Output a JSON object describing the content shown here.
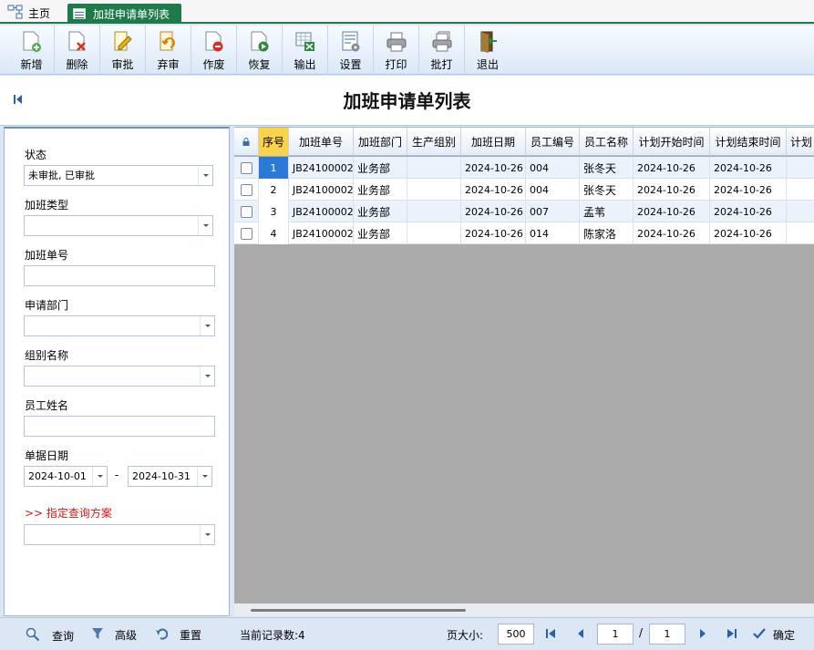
{
  "tabs": {
    "home_label": "主页",
    "active_label": "加班申请单列表"
  },
  "toolbar": {
    "new": "新增",
    "delete": "删除",
    "approve": "审批",
    "unapprove": "弃审",
    "void": "作废",
    "restore": "恢复",
    "export": "输出",
    "settings": "设置",
    "print": "打印",
    "batch_print": "批打",
    "exit": "退出"
  },
  "page_title": "加班申请单列表",
  "filters": {
    "status_label": "状态",
    "status_value": "未审批, 已审批",
    "ot_type_label": "加班类型",
    "ot_type_value": "",
    "ot_no_label": "加班单号",
    "ot_no_value": "",
    "dept_label": "申请部门",
    "dept_value": "",
    "group_label": "组别名称",
    "group_value": "",
    "employee_label": "员工姓名",
    "employee_value": "",
    "date_label": "单据日期",
    "date_from": "2024-10-01",
    "date_sep": "-",
    "date_to": "2024-10-31",
    "scheme_label": ">> 指定查询方案",
    "scheme_value": ""
  },
  "grid": {
    "headers": {
      "seq": "序号",
      "ot_no": "加班单号",
      "dept": "加班部门",
      "group": "生产组别",
      "date": "加班日期",
      "emp_no": "员工编号",
      "emp_name": "员工名称",
      "plan_start": "计划开始时间",
      "plan_end": "计划结束时间",
      "more": "计划"
    },
    "rows": [
      {
        "seq": "1",
        "ot_no": "JB24100002",
        "dept": "业务部",
        "group": "",
        "date": "2024-10-26",
        "emp_no": "004",
        "emp_name": "张冬天",
        "plan_start": "2024-10-26",
        "plan_end": "2024-10-26"
      },
      {
        "seq": "2",
        "ot_no": "JB24100002",
        "dept": "业务部",
        "group": "",
        "date": "2024-10-26",
        "emp_no": "004",
        "emp_name": "张冬天",
        "plan_start": "2024-10-26",
        "plan_end": "2024-10-26"
      },
      {
        "seq": "3",
        "ot_no": "JB24100002",
        "dept": "业务部",
        "group": "",
        "date": "2024-10-26",
        "emp_no": "007",
        "emp_name": "孟苇",
        "plan_start": "2024-10-26",
        "plan_end": "2024-10-26"
      },
      {
        "seq": "4",
        "ot_no": "JB24100002",
        "dept": "业务部",
        "group": "",
        "date": "2024-10-26",
        "emp_no": "014",
        "emp_name": "陈家洛",
        "plan_start": "2024-10-26",
        "plan_end": "2024-10-26"
      }
    ]
  },
  "bottom": {
    "query": "查询",
    "advanced": "高级",
    "reset": "重置",
    "record_count": "当前记录数:4",
    "page_size_label": "页大小:",
    "page_size": "500",
    "current_page": "1",
    "page_sep": "/",
    "total_pages": "1",
    "confirm": "确定"
  },
  "colors": {
    "accent_green": "#1f7a4a",
    "selected_blue": "#2b79d7",
    "header_seq_yellow": "#f9d44a",
    "label_red": "#d01818"
  }
}
